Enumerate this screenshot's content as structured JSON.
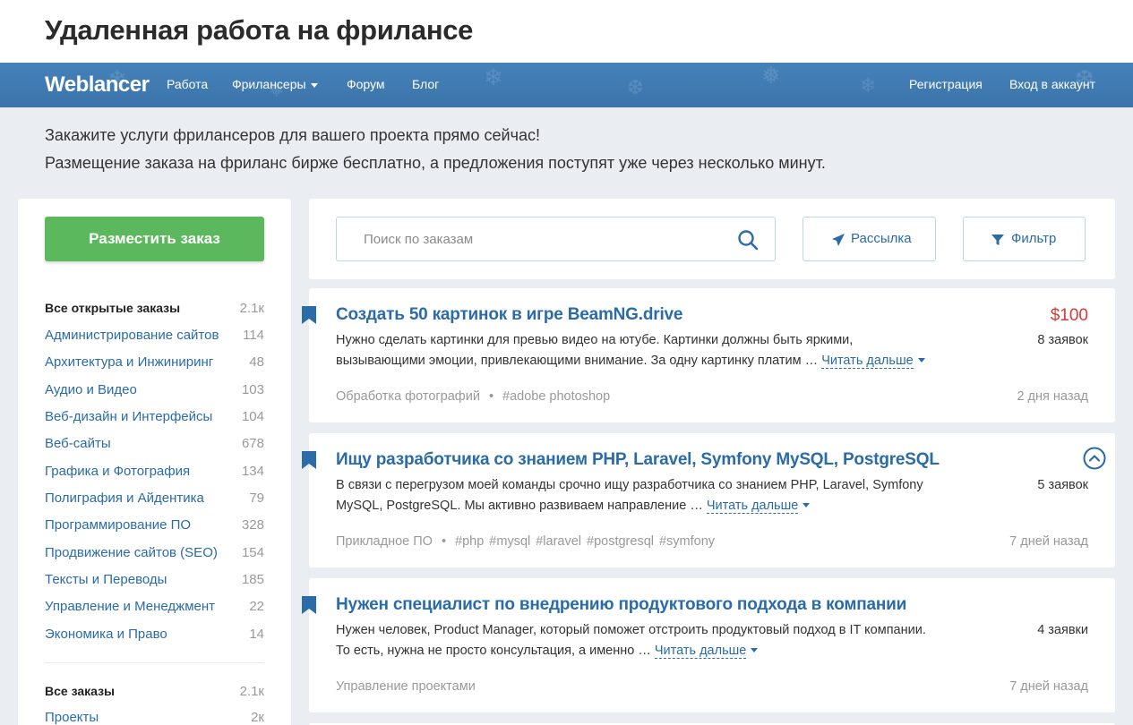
{
  "page": {
    "heading": "Удаленная работа на фрилансе"
  },
  "navbar": {
    "logo": "Weblancer",
    "links": [
      {
        "label": "Работа"
      },
      {
        "label": "Фрилансеры"
      },
      {
        "label": "Форум"
      },
      {
        "label": "Блог"
      }
    ],
    "register": "Регистрация",
    "login": "Вход в аккаунт"
  },
  "promo": {
    "line1": "Закажите услуги фрилансеров для вашего проекта прямо сейчас!",
    "line2": "Размещение заказа на фриланс бирже бесплатно, а предложения поступят уже через несколько минут."
  },
  "sidebar": {
    "post_button": "Разместить заказ",
    "open_orders": {
      "label": "Все открытые заказы",
      "count": "2.1к"
    },
    "categories": [
      {
        "label": "Администрирование сайтов",
        "count": "114"
      },
      {
        "label": "Архитектура и Инжиниринг",
        "count": "48"
      },
      {
        "label": "Аудио и Видео",
        "count": "103"
      },
      {
        "label": "Веб-дизайн и Интерфейсы",
        "count": "104"
      },
      {
        "label": "Веб-сайты",
        "count": "678"
      },
      {
        "label": "Графика и Фотография",
        "count": "134"
      },
      {
        "label": "Полиграфия и Айдентика",
        "count": "79"
      },
      {
        "label": "Программирование ПО",
        "count": "328"
      },
      {
        "label": "Продвижение сайтов (SEO)",
        "count": "154"
      },
      {
        "label": "Тексты и Переводы",
        "count": "185"
      },
      {
        "label": "Управление и Менеджмент",
        "count": "22"
      },
      {
        "label": "Экономика и Право",
        "count": "14"
      }
    ],
    "all_orders": {
      "label": "Все заказы",
      "count": "2.1к"
    },
    "projects": {
      "label": "Проекты",
      "count": "2к"
    }
  },
  "toolbar": {
    "search_placeholder": "Поиск по заказам",
    "mailing_label": "Рассылка",
    "filter_label": "Фильтр"
  },
  "colors": {
    "nav": "#3d77ad",
    "accent": "#5cb85c",
    "link": "#2a6ba8",
    "price": "#d33a3a"
  },
  "orders": [
    {
      "title": "Создать 50 картинок в игре BeamNG.drive",
      "price": "$100",
      "desc_line1": "Нужно сделать картинки для превью видео на ютубе. Картинки должны быть яркими,",
      "desc_line2": "вызывающими эмоции, привлекающими внимание. За одну картинку платим …",
      "read_more": "Читать дальше",
      "bids": "8 заявок",
      "category": "Обработка фотографий",
      "tags": [
        "#adobe photoshop"
      ],
      "time": "2 дня назад"
    },
    {
      "title": "Ищу разработчика со знанием PHP, Laravel, Symfony MySQL, PostgreSQL",
      "desc_line1": "В связи с перегрузом моей команды срочно ищу разработчика со знанием PHP, Laravel, Symfony",
      "desc_line2": "MySQL, PostgreSQL. Мы активно развиваем направление …",
      "read_more": "Читать дальше",
      "bids": "5 заявок",
      "category": "Прикладное ПО",
      "tags": [
        "#php",
        "#mysql",
        "#laravel",
        "#postgresql",
        "#symfony"
      ],
      "time": "7 дней назад"
    },
    {
      "title": "Нужен специалист по внедрению продуктового подхода в компании",
      "desc_line1": "Нужен человек, Product Manager, который поможет отстроить продуктовый подход в IT компании.",
      "desc_line2": "То есть, нужна не просто консультация, а именно …",
      "read_more": "Читать дальше",
      "bids": "4 заявки",
      "category": "Управление проектами",
      "tags": [],
      "time": "7 дней назад"
    }
  ]
}
